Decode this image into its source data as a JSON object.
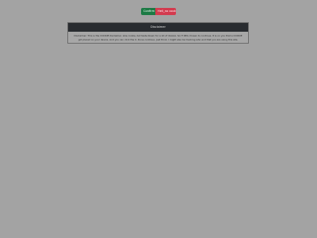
{
  "controls": {
    "confirm_label": "Confirm",
    "reject_label": "Hell_no cookie"
  },
  "disclaimer": {
    "title": "Disclaimer",
    "text": "Disclaimer: This is the COOKIE disclaimer. Like cookie, but taste blown for a lot of dAAAA. So IT REA chosen to continue. It is on you that a COOKIE got placed on your device. And you can click the X. Done continue. Just think. I might also be tracking who and that you are using this site."
  },
  "colors": {
    "background": "#a3a3a3",
    "confirm": "#1c7a44",
    "reject": "#d33a4e",
    "header": "#292c30"
  }
}
